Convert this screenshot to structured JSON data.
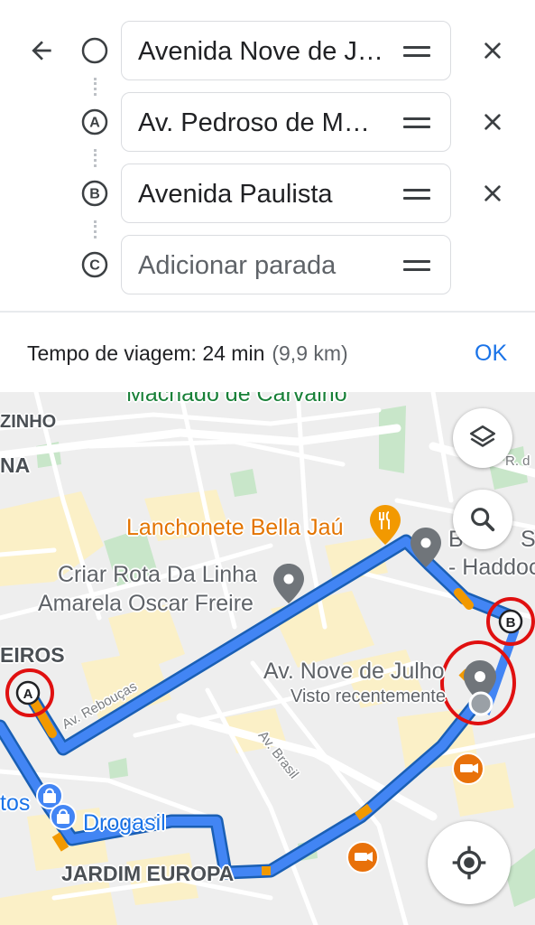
{
  "directions": {
    "stops": [
      {
        "marker": "origin-circle",
        "text": "Avenida Nove de Julho",
        "removable": true
      },
      {
        "marker": "A",
        "text": "Av. Pedroso de Morais",
        "removable": true
      },
      {
        "marker": "B",
        "text": "Avenida Paulista",
        "removable": true
      },
      {
        "marker": "C",
        "placeholder": "Adicionar parada",
        "removable": false
      }
    ],
    "summary": {
      "travel_time": "Tempo de viagem: 24 min",
      "distance": "(9,9 km)"
    },
    "ok_label": "OK"
  },
  "map": {
    "labels": {
      "top_street": "Machado de Carvalho",
      "district_zinho": "ZINHO",
      "district_na": "NA",
      "district_eiros": "EIROS",
      "district_jardim_europa": "JARDIM EUROPA",
      "street_rd": "R. d",
      "street_av_reboucas": "Av. Rebouças",
      "street_av_brasil": "Av. Brasil",
      "poi_lanchonete": "Lanchonete Bella Jaú",
      "poi_criar_rota_1": "Criar Rota Da Linha",
      "poi_criar_rota_2": "Amarela Oscar Freire",
      "poi_bs_1": "B",
      "poi_bs_2": "S",
      "poi_haddock": "- Haddoc",
      "poi_nove_julho": "Av. Nove de Julho",
      "poi_nove_julho_sub": "Visto recentemente",
      "poi_drogasil": "Drogasil",
      "poi_tos": "tos"
    },
    "route_markers": [
      "A",
      "B"
    ],
    "colors": {
      "route": "#4285f4",
      "route_outline": "#1a5fb4",
      "traffic": "#f29900",
      "annotation": "#e01010",
      "pin": "#70757a",
      "food": "#f29900",
      "camera": "#e8710a",
      "shopping": "#4285f4",
      "link": "#1a73e8"
    },
    "controls": {
      "layers": "layers-icon",
      "search": "search-icon",
      "my_location": "my-location-icon"
    }
  }
}
